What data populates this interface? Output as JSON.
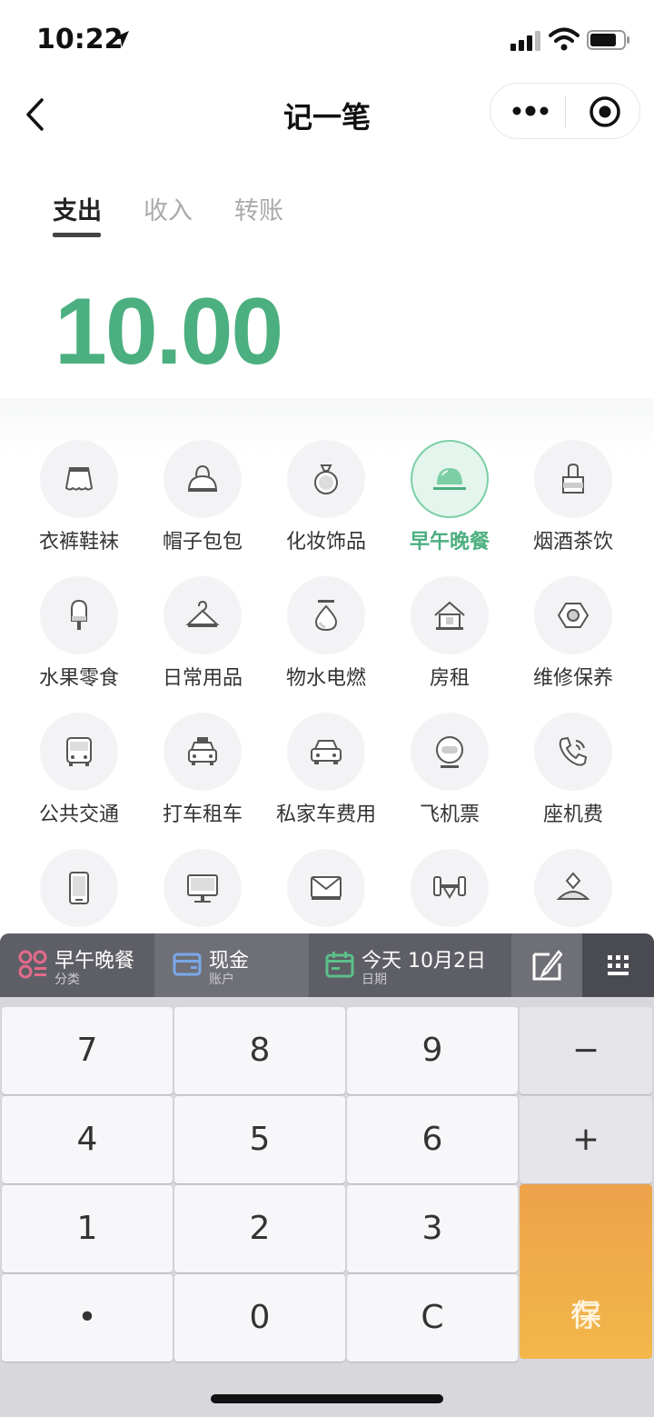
{
  "status": {
    "time": "10:22"
  },
  "nav": {
    "title": "记一笔"
  },
  "tabs": [
    {
      "label": "支出",
      "active": true
    },
    {
      "label": "收入",
      "active": false
    },
    {
      "label": "转账",
      "active": false
    }
  ],
  "amount": "10.00",
  "categories": [
    {
      "label": "衣裤鞋袜",
      "icon": "skirt-icon"
    },
    {
      "label": "帽子包包",
      "icon": "handbag-icon"
    },
    {
      "label": "化妆饰品",
      "icon": "ring-icon"
    },
    {
      "label": "早午晚餐",
      "icon": "dish-cover-icon",
      "selected": true
    },
    {
      "label": "烟酒茶饮",
      "icon": "bottle-icon"
    },
    {
      "label": "水果零食",
      "icon": "popsicle-icon"
    },
    {
      "label": "日常用品",
      "icon": "hanger-icon"
    },
    {
      "label": "物水电燃",
      "icon": "water-drop-icon"
    },
    {
      "label": "房租",
      "icon": "house-icon"
    },
    {
      "label": "维修保养",
      "icon": "nut-icon"
    },
    {
      "label": "公共交通",
      "icon": "bus-icon"
    },
    {
      "label": "打车租车",
      "icon": "taxi-icon"
    },
    {
      "label": "私家车费用",
      "icon": "car-icon"
    },
    {
      "label": "飞机票",
      "icon": "plane-window-icon"
    },
    {
      "label": "座机费",
      "icon": "phone-icon"
    },
    {
      "label": "",
      "icon": "mobile-phone-icon"
    },
    {
      "label": "",
      "icon": "monitor-icon"
    },
    {
      "label": "",
      "icon": "envelope-icon"
    },
    {
      "label": "",
      "icon": "dumbbell-icon"
    },
    {
      "label": "",
      "icon": "diamond-icon"
    }
  ],
  "info_bar": {
    "category": {
      "value": "早午晚餐",
      "label": "分类"
    },
    "account": {
      "value": "现金",
      "label": "账户"
    },
    "date": {
      "value": "今天 10月2日",
      "label": "日期"
    }
  },
  "keypad": {
    "rows": [
      [
        "7",
        "8",
        "9",
        "−"
      ],
      [
        "4",
        "5",
        "6",
        "+"
      ],
      [
        "1",
        "2",
        "3"
      ],
      [
        "•",
        "0",
        "C"
      ]
    ],
    "save_label": "保存",
    "save_lines": [
      "保",
      "存"
    ]
  },
  "colors": {
    "accent": "#4caf80",
    "save": "#f0a84a",
    "category_icon": "#e56a8a",
    "account_icon": "#7aa8e8",
    "date_icon": "#5cc08a"
  }
}
